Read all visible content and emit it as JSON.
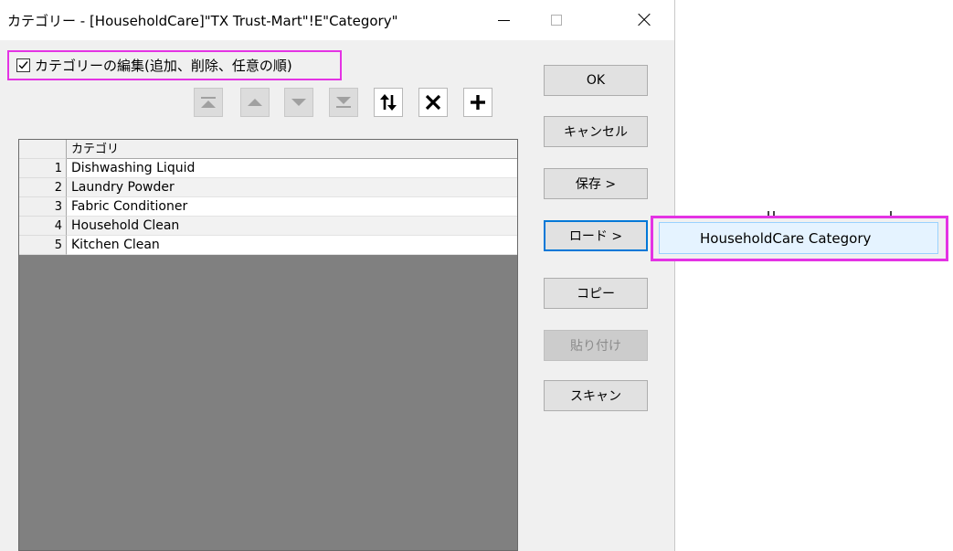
{
  "window": {
    "title": "カテゴリー - [HouseholdCare]\"TX Trust-Mart\"!E\"Category\""
  },
  "edit_option": {
    "label": "カテゴリーの編集(追加、削除、任意の順)",
    "checked": true
  },
  "toolbar": {
    "icons": [
      "move-to-top-icon",
      "move-up-icon",
      "move-down-icon",
      "move-to-bottom-icon",
      "sort-icon",
      "delete-icon",
      "add-icon"
    ]
  },
  "grid": {
    "column_header": "カテゴリ",
    "rows": [
      {
        "num": "1",
        "value": "Dishwashing Liquid"
      },
      {
        "num": "2",
        "value": "Laundry Powder"
      },
      {
        "num": "3",
        "value": "Fabric Conditioner"
      },
      {
        "num": "4",
        "value": "Household Clean"
      },
      {
        "num": "5",
        "value": "Kitchen Clean"
      }
    ]
  },
  "buttons": {
    "ok": "OK",
    "cancel": "キャンセル",
    "save": "保存 >",
    "load": "ロード >",
    "copy": "コピー",
    "paste": "貼り付け",
    "scan": "スキャン"
  },
  "load_menu": {
    "items": [
      "HouseholdCare Category"
    ]
  },
  "colors": {
    "highlight": "#e433e4",
    "focus": "#0078d7",
    "menu_hover": "#e5f3ff"
  }
}
